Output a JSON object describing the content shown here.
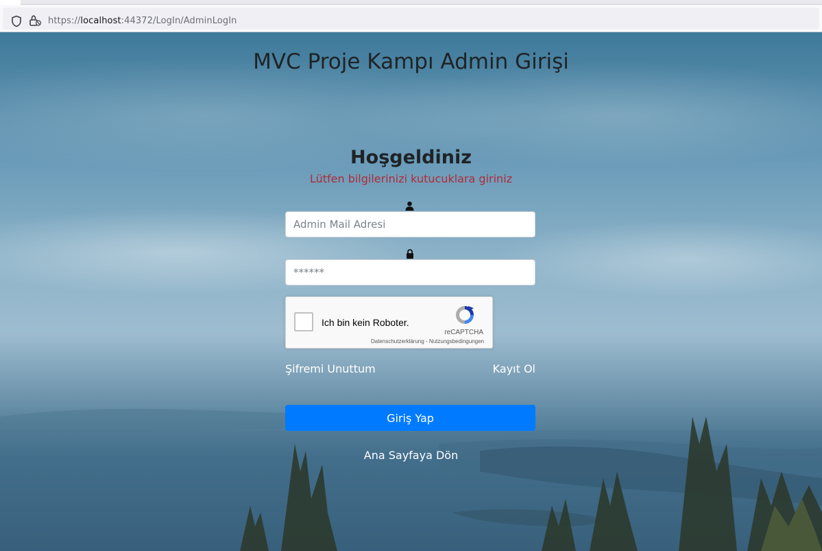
{
  "browser": {
    "url_prefix": "https://",
    "url_host": "localhost",
    "url_rest": ":44372/LogIn/AdminLogIn"
  },
  "page": {
    "title": "MVC Proje Kampı Admin Girişi",
    "welcome": "Hoşgeldiniz",
    "subtitle": "Lütfen bilgilerinizi kutucuklara giriniz",
    "mail_placeholder": "Admin Mail Adresi",
    "password_placeholder": "******",
    "forgot_password": "Şifremi Unuttum",
    "register": "Kayıt Ol",
    "login_button": "Giriş Yap",
    "home_link": "Ana Sayfaya Dön"
  },
  "recaptcha": {
    "label": "Ich bin kein Roboter.",
    "brand": "reCAPTCHA",
    "privacy": "Datenschutzerklärung",
    "separator": " - ",
    "terms": "Nutzungsbedingungen"
  },
  "colors": {
    "primary_button": "#007bff",
    "subtitle": "#b02a37",
    "title_text": "#1f2326"
  },
  "icons": {
    "tracking": "shield-icon",
    "security": "lock-icon",
    "user_field": "user-icon",
    "password_field": "lock-icon",
    "captcha": "recaptcha-logo-icon"
  }
}
